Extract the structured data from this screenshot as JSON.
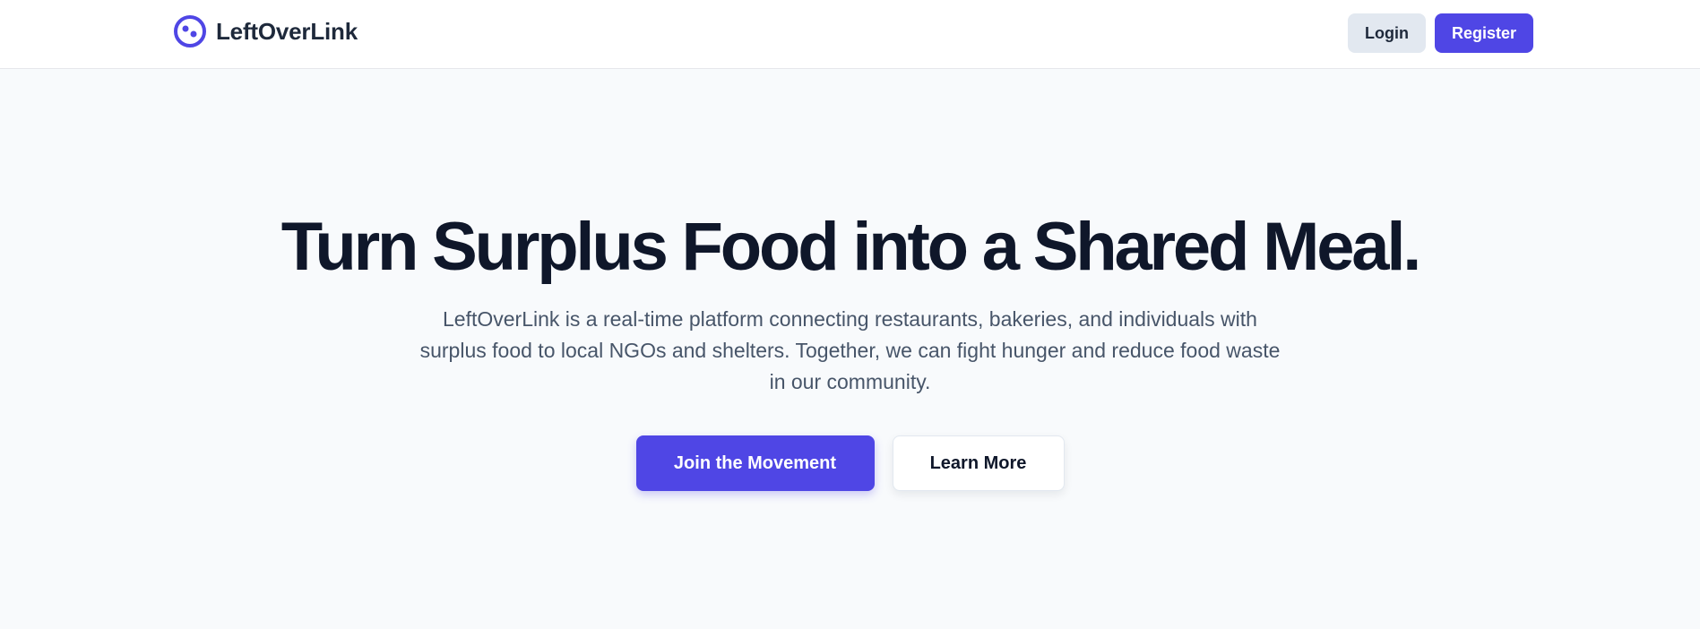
{
  "header": {
    "brand_name": "LeftOverLink",
    "logo_icon": "logo-icon",
    "login_label": "Login",
    "register_label": "Register"
  },
  "hero": {
    "title": "Turn Surplus Food into a Shared Meal.",
    "description": "LeftOverLink is a real-time platform connecting restaurants, bakeries, and individuals with surplus food to local NGOs and shelters. Together, we can fight hunger and reduce food waste in our community.",
    "primary_cta": "Join the Movement",
    "secondary_cta": "Learn More"
  },
  "colors": {
    "accent": "#4f46e5",
    "page_background": "#f8fafc",
    "heading": "#0f172a",
    "body_text": "#475569"
  }
}
